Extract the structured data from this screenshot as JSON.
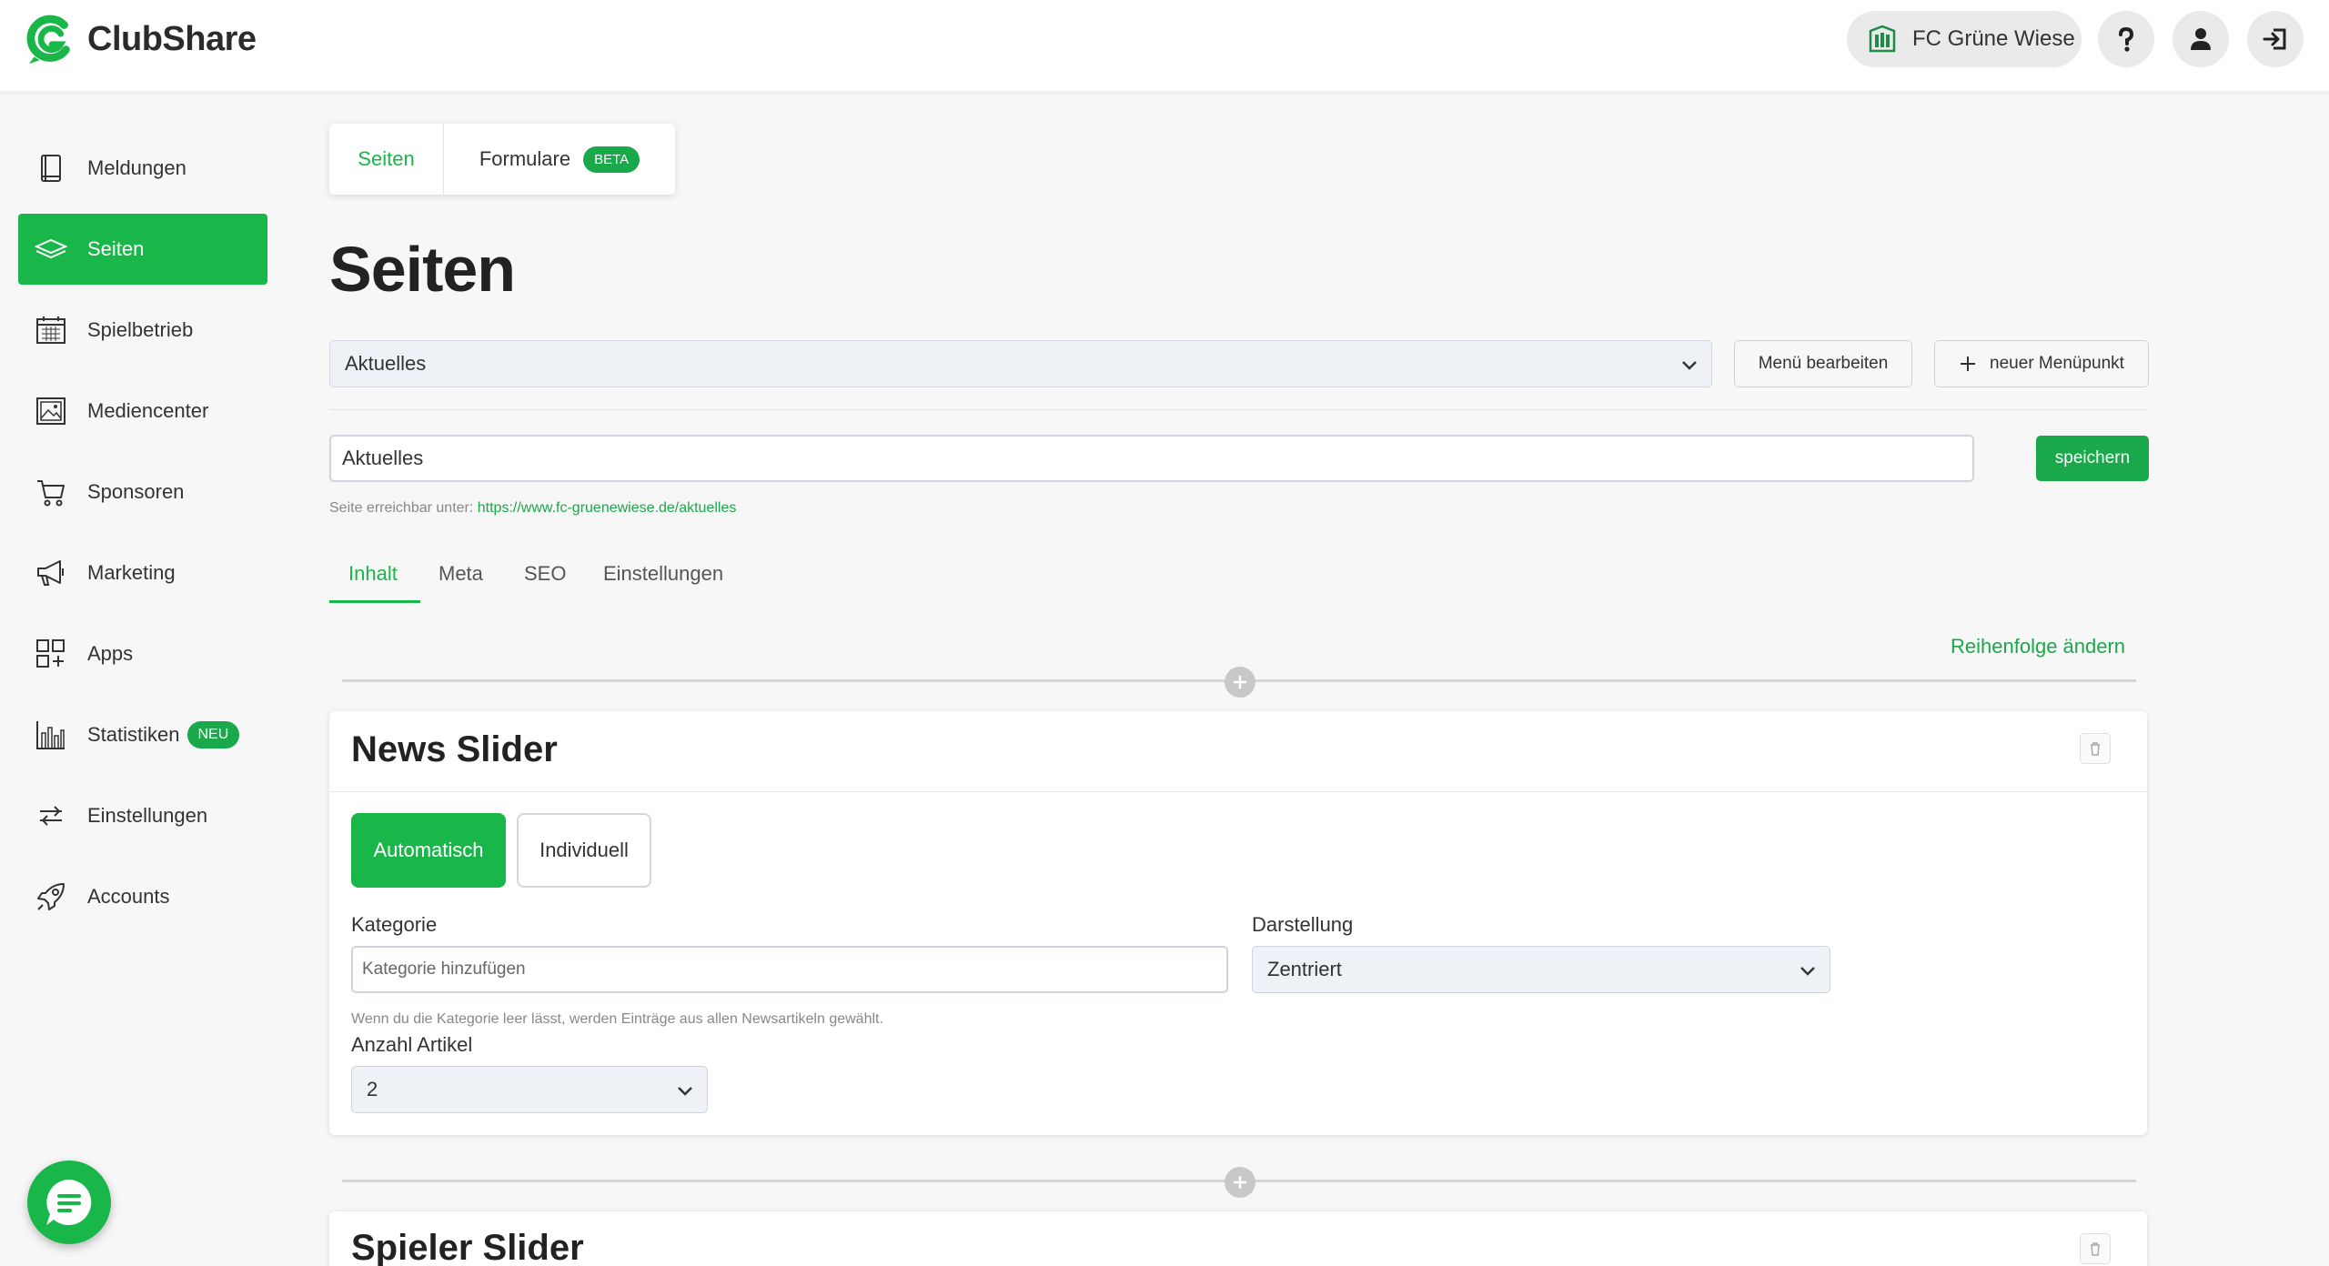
{
  "app": {
    "name": "ClubShare"
  },
  "header": {
    "club_name": "FC Grüne Wiese"
  },
  "sidebar": {
    "items": [
      {
        "label": "Meldungen",
        "icon": "book-icon"
      },
      {
        "label": "Seiten",
        "icon": "layers-icon",
        "active": true
      },
      {
        "label": "Spielbetrieb",
        "icon": "calendar-icon"
      },
      {
        "label": "Mediencenter",
        "icon": "image-icon"
      },
      {
        "label": "Sponsoren",
        "icon": "cart-icon"
      },
      {
        "label": "Marketing",
        "icon": "megaphone-icon"
      },
      {
        "label": "Apps",
        "icon": "apps-icon"
      },
      {
        "label": "Statistiken",
        "icon": "bar-chart-icon",
        "badge": "NEU"
      },
      {
        "label": "Einstellungen",
        "icon": "sliders-icon"
      },
      {
        "label": "Accounts",
        "icon": "rocket-icon"
      }
    ]
  },
  "top_tabs": {
    "seiten": "Seiten",
    "formulare": "Formulare",
    "beta": "BETA"
  },
  "page_title": "Seiten",
  "menu_select": {
    "value": "Aktuelles"
  },
  "buttons": {
    "edit_menu": "Menü bearbeiten",
    "new_item": "neuer Menüpunkt",
    "save": "speichern",
    "reorder": "Reihenfolge ändern"
  },
  "title_input": {
    "value": "Aktuelles"
  },
  "reach": {
    "prefix": "Seite erreichbar unter:",
    "url": "https://www.fc-gruenewiese.de/aktuelles"
  },
  "sub_tabs": [
    "Inhalt",
    "Meta",
    "SEO",
    "Einstellungen"
  ],
  "news_slider": {
    "title": "News Slider",
    "mode_auto": "Automatisch",
    "mode_custom": "Individuell",
    "kategorie_label": "Kategorie",
    "kategorie_placeholder": "Kategorie hinzufügen",
    "darstellung_label": "Darstellung",
    "darstellung_value": "Zentriert",
    "help": "Wenn du die Kategorie leer lässt, werden Einträge aus allen Newsartikeln gewählt.",
    "anzahl_label": "Anzahl Artikel",
    "anzahl_value": "2"
  },
  "spieler_slider": {
    "title": "Spieler Slider"
  },
  "colors": {
    "accent": "#19b649",
    "accent_dark": "#19a84a"
  }
}
